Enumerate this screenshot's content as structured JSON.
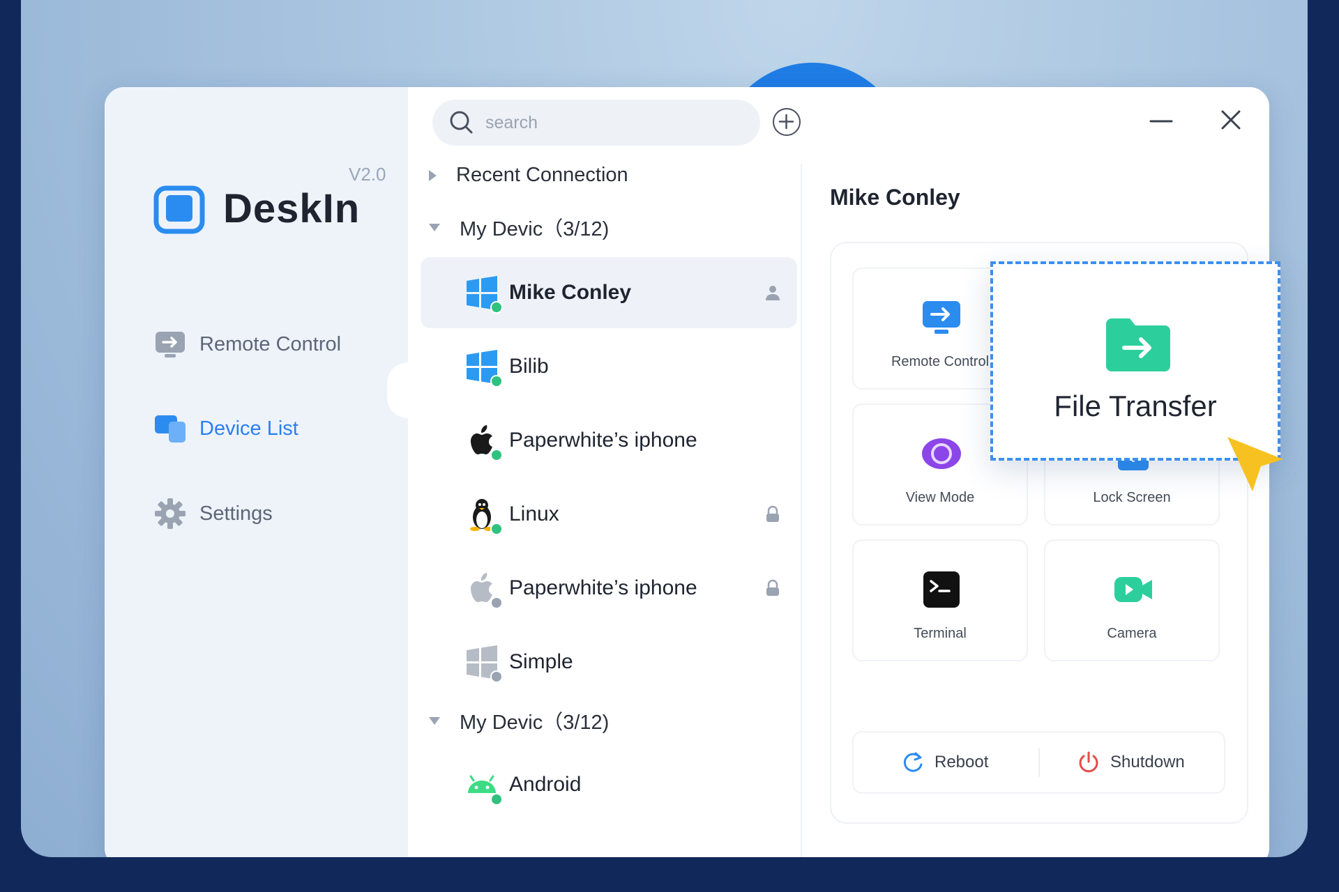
{
  "app": {
    "name": "DeskIn",
    "version": "V2.0"
  },
  "sidebar": {
    "items": [
      {
        "label": "Remote Control",
        "icon": "remote-control-icon",
        "active": false
      },
      {
        "label": "Device List",
        "icon": "device-list-icon",
        "active": true
      },
      {
        "label": "Settings",
        "icon": "gear-icon",
        "active": false
      }
    ]
  },
  "search": {
    "placeholder": "search",
    "value": ""
  },
  "device_list": {
    "groups": [
      {
        "label": "Recent Connection",
        "expanded": false
      },
      {
        "label": "My Devic（3/12)",
        "expanded": true
      },
      {
        "label": "My Devic（3/12)",
        "expanded": true
      }
    ],
    "devices": [
      {
        "name": "Mike Conley",
        "os": "windows-icon",
        "online": true,
        "selected": true,
        "badge": "user-icon"
      },
      {
        "name": "Bilib",
        "os": "windows-icon",
        "online": true,
        "selected": false,
        "badge": ""
      },
      {
        "name": "Paperwhite’s iphone",
        "os": "apple-icon",
        "online": true,
        "selected": false,
        "badge": ""
      },
      {
        "name": "Linux",
        "os": "linux-icon",
        "online": true,
        "selected": false,
        "badge": "lock-icon"
      },
      {
        "name": "Paperwhite’s iphone",
        "os": "apple-icon",
        "online": false,
        "selected": false,
        "badge": "lock-icon"
      },
      {
        "name": "Simple",
        "os": "windows-icon",
        "online": false,
        "selected": false,
        "badge": ""
      },
      {
        "name": "Android",
        "os": "android-icon",
        "online": true,
        "selected": false,
        "badge": ""
      }
    ]
  },
  "detail": {
    "title": "Mike Conley",
    "tiles": [
      {
        "label": "Remote Control",
        "icon": "remote-control-icon",
        "color": "#2b8cf0"
      },
      {
        "label": "View Mode",
        "icon": "eye-icon",
        "color": "#8b45e8"
      },
      {
        "label": "Lock Screen",
        "icon": "lock-icon",
        "color": "#2b8cf0"
      },
      {
        "label": "Terminal",
        "icon": "terminal-icon",
        "color": "#111111"
      },
      {
        "label": "Camera",
        "icon": "camera-icon",
        "color": "#2ccf9c"
      }
    ],
    "actions": [
      {
        "label": "Reboot",
        "icon": "reboot-icon",
        "color": "#2b8cf0"
      },
      {
        "label": "Shutdown",
        "icon": "power-icon",
        "color": "#e84a4a"
      }
    ]
  },
  "highlight": {
    "label": "File Transfer",
    "icon": "folder-transfer-icon",
    "color": "#2ccf9c"
  },
  "colors": {
    "accent": "#2b7ff0",
    "online": "#2ec27e",
    "offline": "#9aa3b2",
    "background": "#11295a"
  }
}
